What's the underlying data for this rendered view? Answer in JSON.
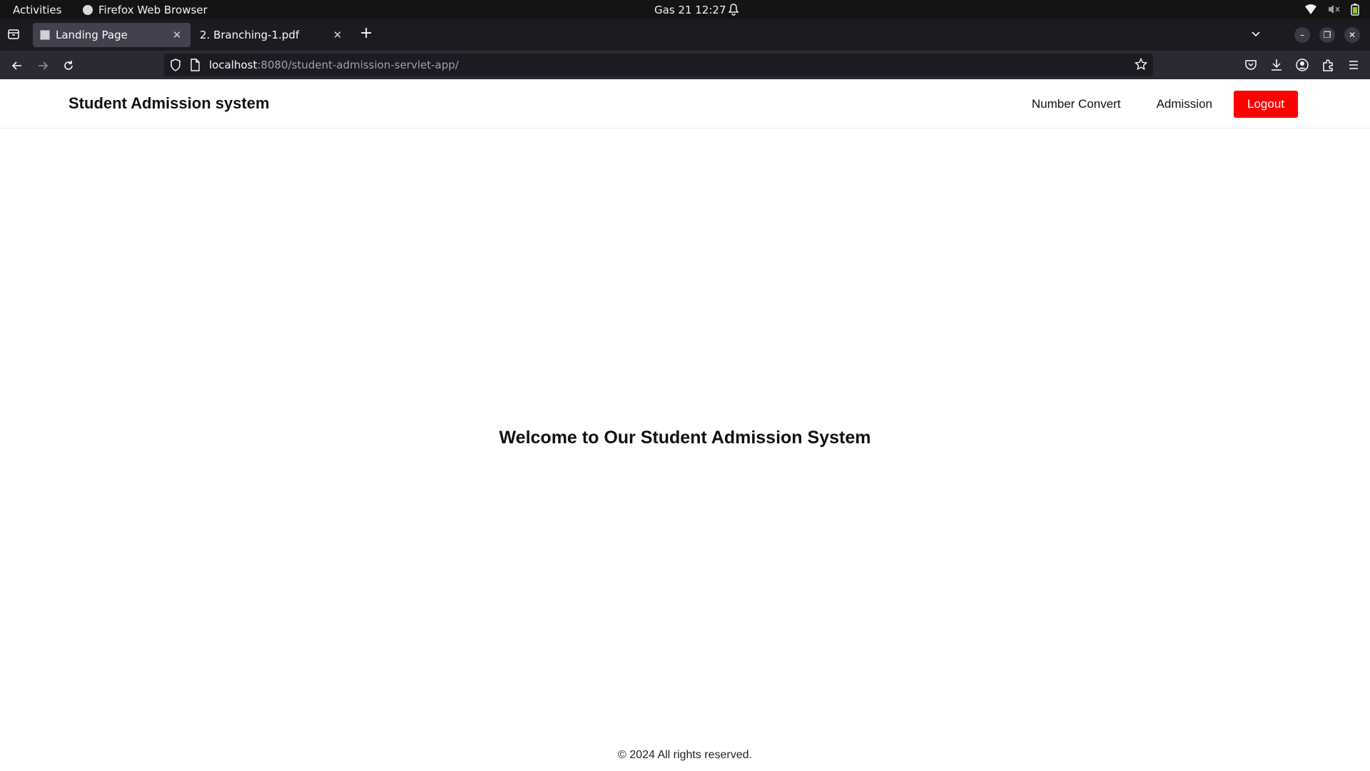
{
  "system_bar": {
    "activities": "Activities",
    "app_name": "Firefox Web Browser",
    "clock": "Gas 21  12:27"
  },
  "browser": {
    "tabs": [
      {
        "title": "Landing Page",
        "active": true
      },
      {
        "title": "2. Branching-1.pdf",
        "active": false
      }
    ],
    "url_host": "localhost",
    "url_rest": ":8080/student-admission-servlet-app/"
  },
  "site": {
    "brand": "Student Admission system",
    "nav": {
      "number_convert": "Number Convert",
      "admission": "Admission",
      "logout": "Logout"
    },
    "welcome": "Welcome to Our Student Admission System",
    "footer": "© 2024 All rights reserved."
  },
  "colors": {
    "logout_button": "#ff0000",
    "top_bar": "#141414",
    "tab_strip": "#1c1b22",
    "nav_bar": "#2b2a33"
  }
}
